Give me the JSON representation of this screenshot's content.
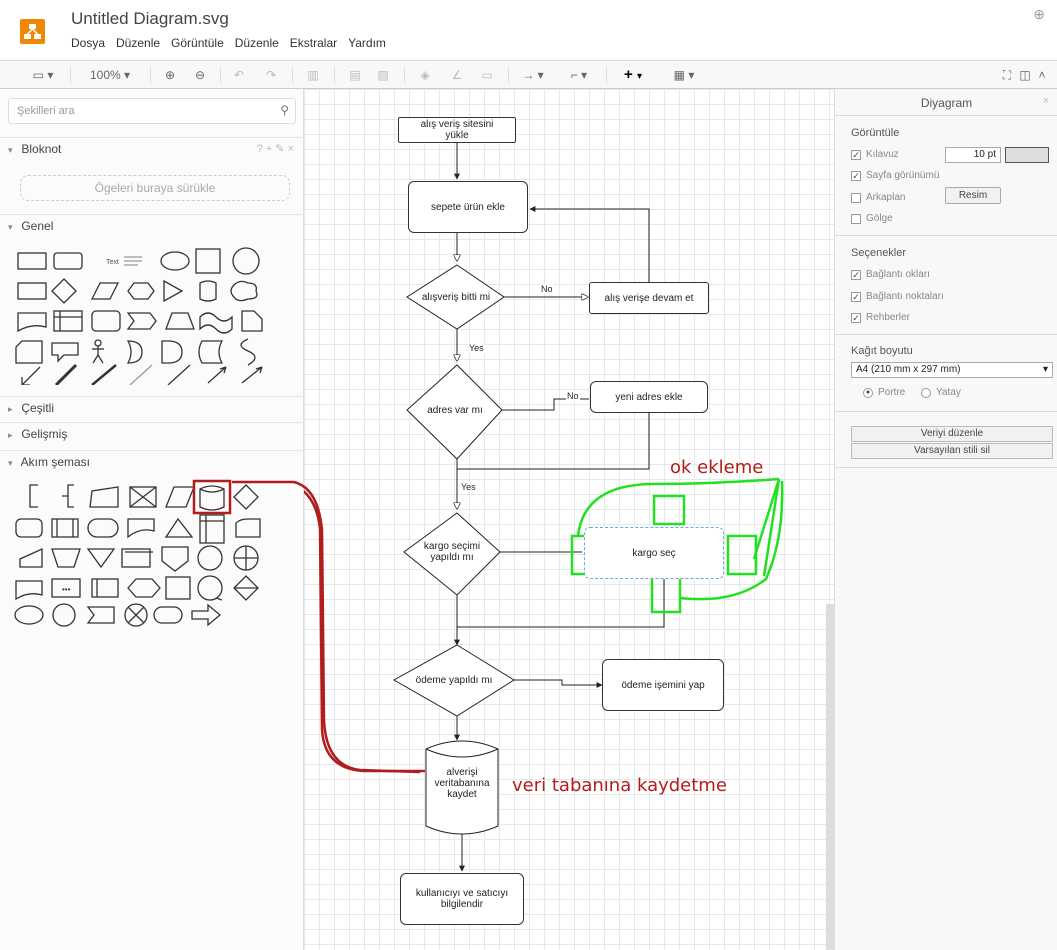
{
  "header": {
    "title": "Untitled Diagram.svg",
    "menu": [
      "Dosya",
      "Düzenle",
      "Görüntüle",
      "Düzenle",
      "Ekstralar",
      "Yardım"
    ]
  },
  "toolbar": {
    "zoom": "100%"
  },
  "left_panel": {
    "search_placeholder": "Şekilleri ara",
    "sections": {
      "bloknot": "Bloknot",
      "genel": "Genel",
      "cesitli": "Çeşitli",
      "gelismis": "Gelişmiş",
      "akim": "Akım şeması"
    },
    "dropzone": "Ögeleri buraya sürükle",
    "text_shape_label": "Text",
    "bloknot_tools": "? + ✎ ×"
  },
  "diagram": {
    "n1": "alış veriş sitesini\nyükle",
    "n2": "sepete ürün ekle",
    "n3": "alışveriş bitti mi",
    "n4": "alış verişe devam et",
    "n5": "adres  var mı",
    "n6": "yeni adres ekle",
    "n7": "kargo seçimi\nyapıldı mı",
    "n8": "kargo seç",
    "n9": "ödeme  yapıldı mı",
    "n10": "ödeme işemini yap",
    "n11": "alverişi\nveritabanına\nkaydet",
    "n12": "kullanıcıyı ve satıcıyı\nbilgilendir",
    "lbl_no1": "No",
    "lbl_yes1": "Yes",
    "lbl_no2": "No",
    "lbl_yes2": "Yes"
  },
  "annotations": {
    "ok_ekleme": "ok ekleme",
    "veri_tabani": "veri tabanına kaydetme"
  },
  "right_panel": {
    "title": "Diyagram",
    "gorunum": "Görüntüle",
    "kilavuz": "Kılavuz",
    "grid_size": "10 pt",
    "sayfa": "Sayfa görünümü",
    "arkaplan": "Arkaplan",
    "resim": "Resim",
    "golge": "Gölge",
    "secenekler": "Seçenekler",
    "baglanti_oklari": "Bağlantı okları",
    "baglanti_noktalari": "Bağlantı noktaları",
    "rehberler": "Rehberler",
    "kagit": "Kağıt boyutu",
    "kagit_value": "A4 (210 mm x 297 mm)",
    "portre": "Portre",
    "yatay": "Yatay",
    "veriyi_duzenle": "Veriyi düzenle",
    "varsayilan": "Varsayılan stili sil"
  },
  "colors": {
    "accent": "#f08705",
    "annotation_green": "#22e022",
    "annotation_red": "#b11c1c"
  }
}
